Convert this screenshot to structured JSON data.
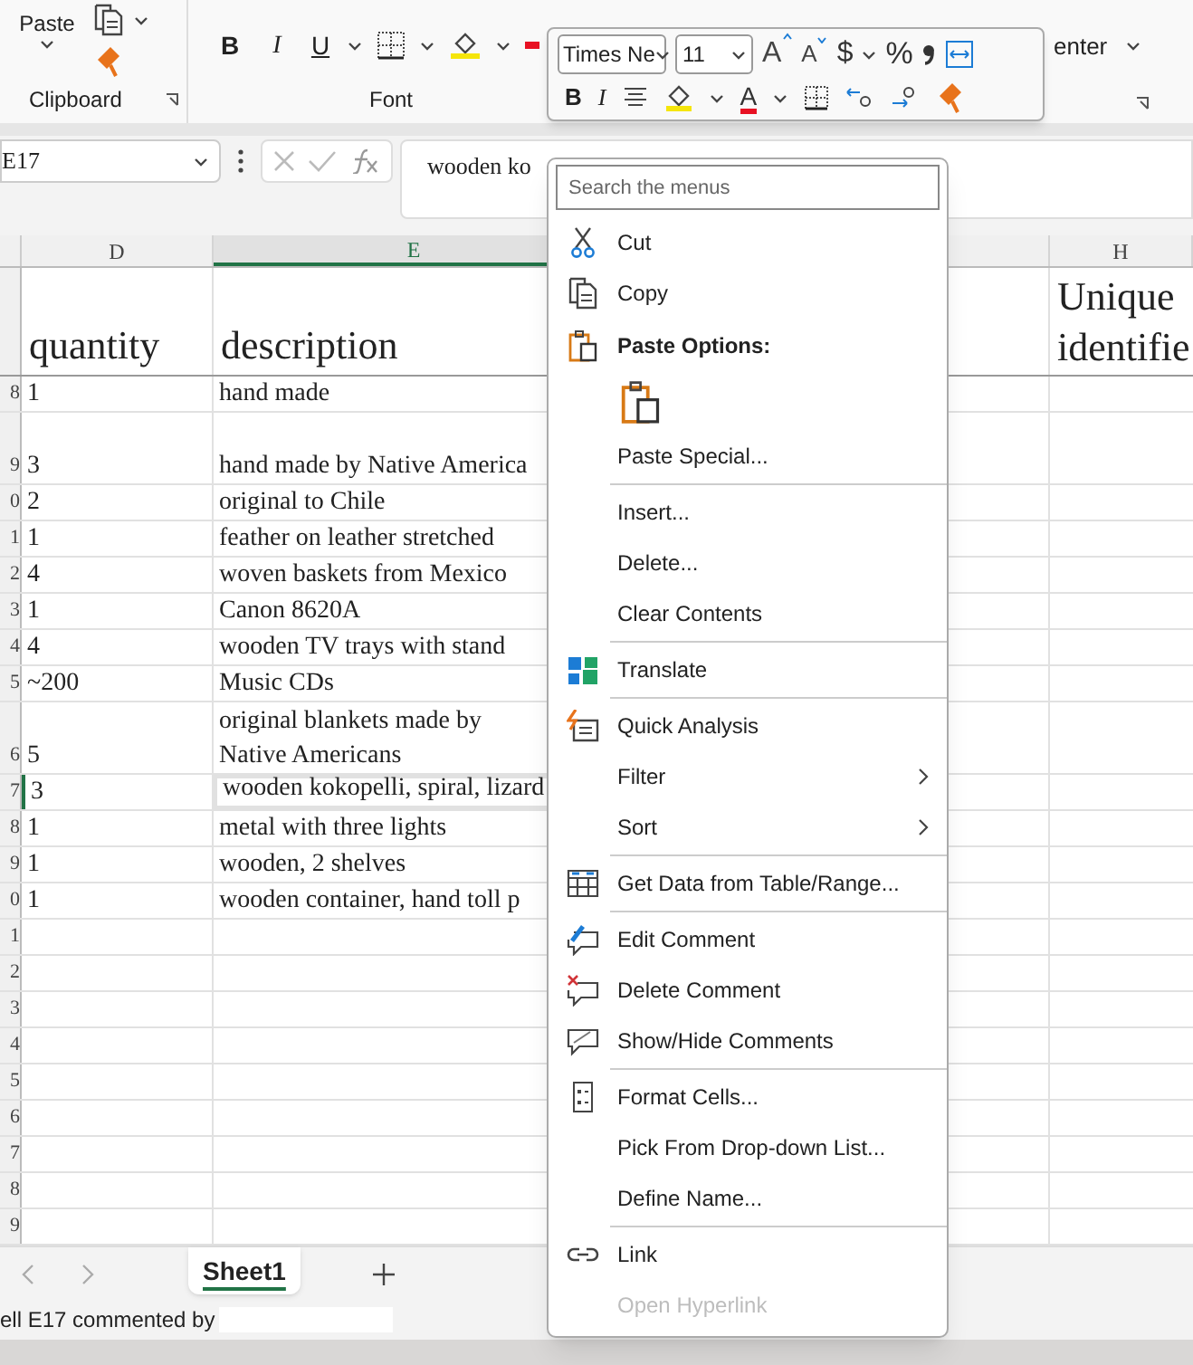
{
  "ribbon": {
    "paste_label": "Paste",
    "clipboard_label": "Clipboard",
    "bold": "B",
    "italic": "I",
    "underline": "U",
    "font_label": "Font",
    "merge_label": "enter"
  },
  "mini_toolbar": {
    "font_name": "Times Ne",
    "font_size": "11",
    "grow": "A",
    "shrink": "A",
    "currency": "$",
    "percent": "%",
    "bold": "B",
    "italic": "I",
    "font_color": "A"
  },
  "formula_bar": {
    "name_box": "E17",
    "formula": "wooden ko"
  },
  "sheet": {
    "columns": [
      {
        "label": "D",
        "selected": false
      },
      {
        "label": "E",
        "selected": true
      },
      {
        "label": "H",
        "selected": false
      }
    ],
    "header_cells": [
      "quantity",
      "description",
      "Unique\nidentifie"
    ],
    "rows": [
      {
        "number": "8",
        "quantity": "1",
        "description": "hand made",
        "tall": false,
        "selected": false
      },
      {
        "number": "9",
        "quantity": "3",
        "description": "hand made by Native America",
        "tall": true,
        "selected": false
      },
      {
        "number": "0",
        "quantity": "2",
        "description": "original to Chile",
        "tall": false,
        "selected": false
      },
      {
        "number": "1",
        "quantity": "1",
        "description": "feather  on leather stretched",
        "tall": false,
        "selected": false
      },
      {
        "number": "2",
        "quantity": "4",
        "description": "woven baskets from Mexico",
        "tall": false,
        "selected": false
      },
      {
        "number": "3",
        "quantity": "1",
        "description": "Canon 8620A",
        "tall": false,
        "selected": false
      },
      {
        "number": "4",
        "quantity": "4",
        "description": "wooden TV trays with stand",
        "tall": false,
        "selected": false
      },
      {
        "number": "5",
        "quantity": "~200",
        "description": "Music CDs",
        "tall": false,
        "selected": false
      },
      {
        "number": "6",
        "quantity": "5",
        "description": "original blankets made by\nNative Americans",
        "tall": true,
        "selected": false
      },
      {
        "number": "7",
        "quantity": "3",
        "description": "wooden kokopelli, spiral, lizard",
        "tall": false,
        "selected": true
      },
      {
        "number": "8",
        "quantity": "1",
        "description": "metal with three lights",
        "tall": false,
        "selected": false
      },
      {
        "number": "9",
        "quantity": "1",
        "description": "wooden, 2 shelves",
        "tall": false,
        "selected": false
      },
      {
        "number": "0",
        "quantity": "1",
        "description": "wooden container, hand  toll p",
        "tall": false,
        "selected": false
      },
      {
        "number": "1",
        "tall": false,
        "selected": false
      },
      {
        "number": "2",
        "tall": false,
        "selected": false
      },
      {
        "number": "3",
        "tall": false,
        "selected": false
      },
      {
        "number": "4",
        "tall": false,
        "selected": false
      },
      {
        "number": "5",
        "tall": false,
        "selected": false
      },
      {
        "number": "6",
        "tall": false,
        "selected": false
      },
      {
        "number": "7",
        "tall": false,
        "selected": false
      },
      {
        "number": "8",
        "tall": false,
        "selected": false
      },
      {
        "number": "9",
        "tall": false,
        "selected": false
      }
    ]
  },
  "sheet_tabs": [
    {
      "label": "Sheet1",
      "selected": true
    }
  ],
  "status_bar": "ell E17 commented by",
  "context_menu": [
    {
      "kind": "search",
      "placeholder": "Search the menus"
    },
    {
      "kind": "item",
      "label": "Cut",
      "disabled": false
    },
    {
      "kind": "item",
      "label": "Copy",
      "disabled": false
    },
    {
      "kind": "heading",
      "label": "Paste Options:"
    },
    {
      "kind": "paste_button"
    },
    {
      "kind": "item",
      "label": "Paste Special...",
      "disabled": false
    },
    {
      "kind": "separator"
    },
    {
      "kind": "item",
      "label": "Insert...",
      "disabled": false
    },
    {
      "kind": "item",
      "label": "Delete...",
      "disabled": false
    },
    {
      "kind": "item",
      "label": "Clear Contents",
      "disabled": false
    },
    {
      "kind": "separator"
    },
    {
      "kind": "item",
      "label": "Translate",
      "disabled": false
    },
    {
      "kind": "separator"
    },
    {
      "kind": "item",
      "label": "Quick Analysis",
      "disabled": false
    },
    {
      "kind": "item",
      "label": "Filter",
      "disabled": false,
      "submenu": true
    },
    {
      "kind": "item",
      "label": "Sort",
      "disabled": false,
      "submenu": true
    },
    {
      "kind": "separator"
    },
    {
      "kind": "item",
      "label": "Get Data from Table/Range...",
      "disabled": false
    },
    {
      "kind": "separator"
    },
    {
      "kind": "item",
      "label": "Edit Comment",
      "disabled": false
    },
    {
      "kind": "item",
      "label": "Delete Comment",
      "disabled": false
    },
    {
      "kind": "item",
      "label": "Show/Hide Comments",
      "disabled": false
    },
    {
      "kind": "separator"
    },
    {
      "kind": "item",
      "label": "Format Cells...",
      "disabled": false
    },
    {
      "kind": "item",
      "label": "Pick From Drop-down List...",
      "disabled": false
    },
    {
      "kind": "item",
      "label": "Define Name...",
      "disabled": false
    },
    {
      "kind": "separator"
    },
    {
      "kind": "item",
      "label": "Link",
      "disabled": false
    },
    {
      "kind": "item",
      "label": "Open Hyperlink",
      "disabled": true
    }
  ]
}
